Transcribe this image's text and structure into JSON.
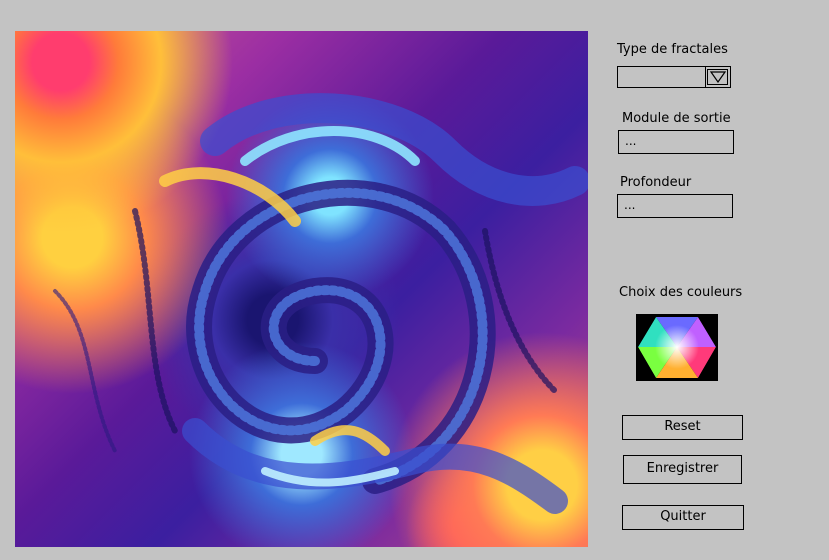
{
  "image": {
    "description": "Fractal rendering (spiral Mandelbrot zoom)"
  },
  "controls": {
    "fractal_type_label": "Type de fractales",
    "fractal_type_value": "",
    "output_module_label": "Module de sortie",
    "output_module_value": "...",
    "depth_label": "Profondeur",
    "depth_value": "...",
    "colors_label": "Choix des couleurs"
  },
  "buttons": {
    "reset": "Reset",
    "save": "Enregistrer",
    "quit": "Quitter"
  },
  "icons": {
    "dropdown": "triangle-down-icon",
    "palette": "color-wheel-icon"
  }
}
